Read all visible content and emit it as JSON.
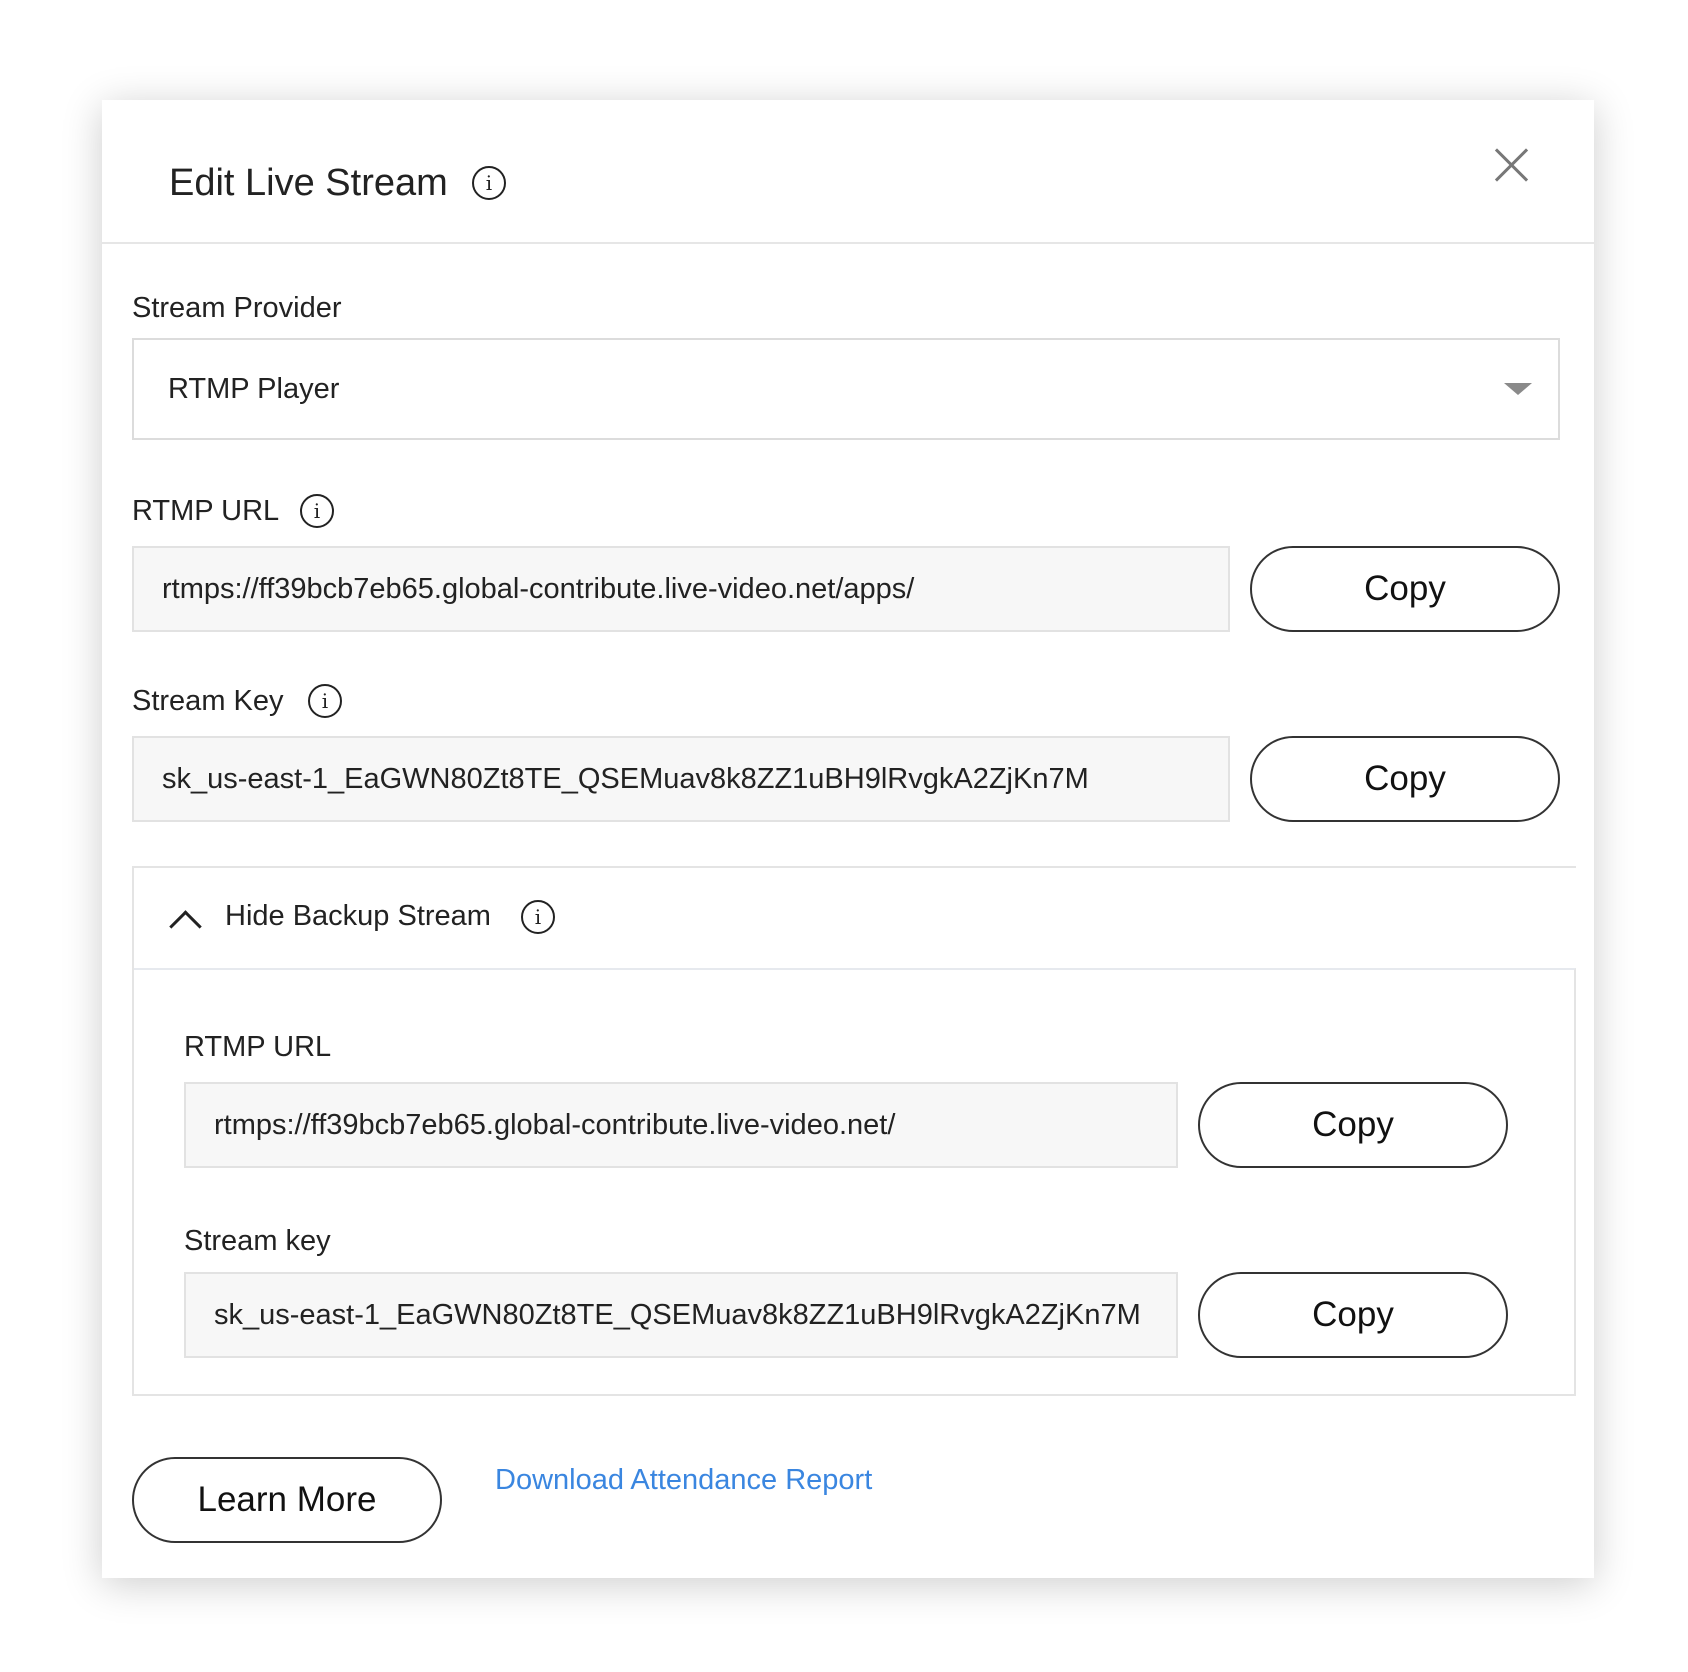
{
  "dialog": {
    "title": "Edit Live Stream",
    "info_icon": "info-icon",
    "close_icon": "close-icon"
  },
  "stream_provider": {
    "label": "Stream Provider",
    "selected": "RTMP Player"
  },
  "primary": {
    "rtmp_url_label": "RTMP URL",
    "rtmp_url_value": "rtmps://ff39bcb7eb65.global-contribute.live-video.net/apps/",
    "stream_key_label": "Stream Key",
    "stream_key_value": "sk_us-east-1_EaGWN80Zt8TE_QSEMuav8k8ZZ1uBH9lRvgkA2ZjKn7M"
  },
  "backup": {
    "toggle_label": "Hide Backup Stream",
    "rtmp_url_label": "RTMP URL",
    "rtmp_url_value": "rtmps://ff39bcb7eb65.global-contribute.live-video.net/",
    "stream_key_label": "Stream key",
    "stream_key_value": "sk_us-east-1_EaGWN80Zt8TE_QSEMuav8k8ZZ1uBH9lRvgkA2ZjKn7M"
  },
  "buttons": {
    "copy": "Copy",
    "learn_more": "Learn More"
  },
  "links": {
    "download_report": "Download Attendance Report"
  },
  "colors": {
    "link": "#3a86e0",
    "field_bg": "#f7f7f7"
  }
}
